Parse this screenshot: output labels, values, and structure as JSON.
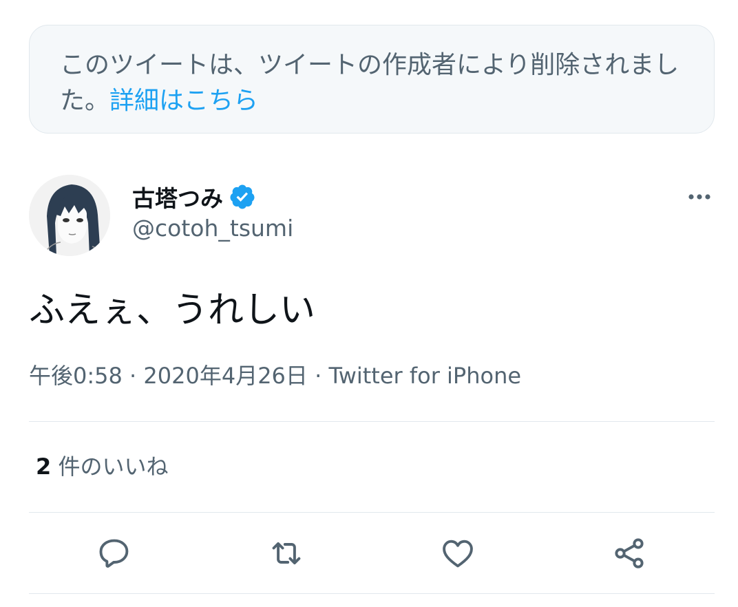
{
  "notice": {
    "text": "このツイートは、ツイートの作成者により削除されました。",
    "link_label": "詳細はこちら"
  },
  "tweet": {
    "display_name": "古塔つみ",
    "handle": "@cotoh_tsumi",
    "verified": true,
    "text": "ふえぇ、うれしい",
    "time": "午後0:58",
    "date": "2020年4月26日",
    "source": "Twitter for iPhone",
    "separator": "·",
    "likes_count": "2",
    "likes_label": " 件のいいね"
  },
  "icons": {
    "avatar": "avatar-illustration",
    "verified": "verified-badge-icon",
    "more": "more-options-icon",
    "reply": "reply-icon",
    "retweet": "retweet-icon",
    "like": "heart-icon",
    "share": "share-icon"
  },
  "colors": {
    "link": "#1da1f2",
    "verified": "#1da1f2",
    "secondary_text": "#536471",
    "primary_text": "#0f1419",
    "notice_bg": "#f5f8fa",
    "border": "#e1e8ed"
  }
}
